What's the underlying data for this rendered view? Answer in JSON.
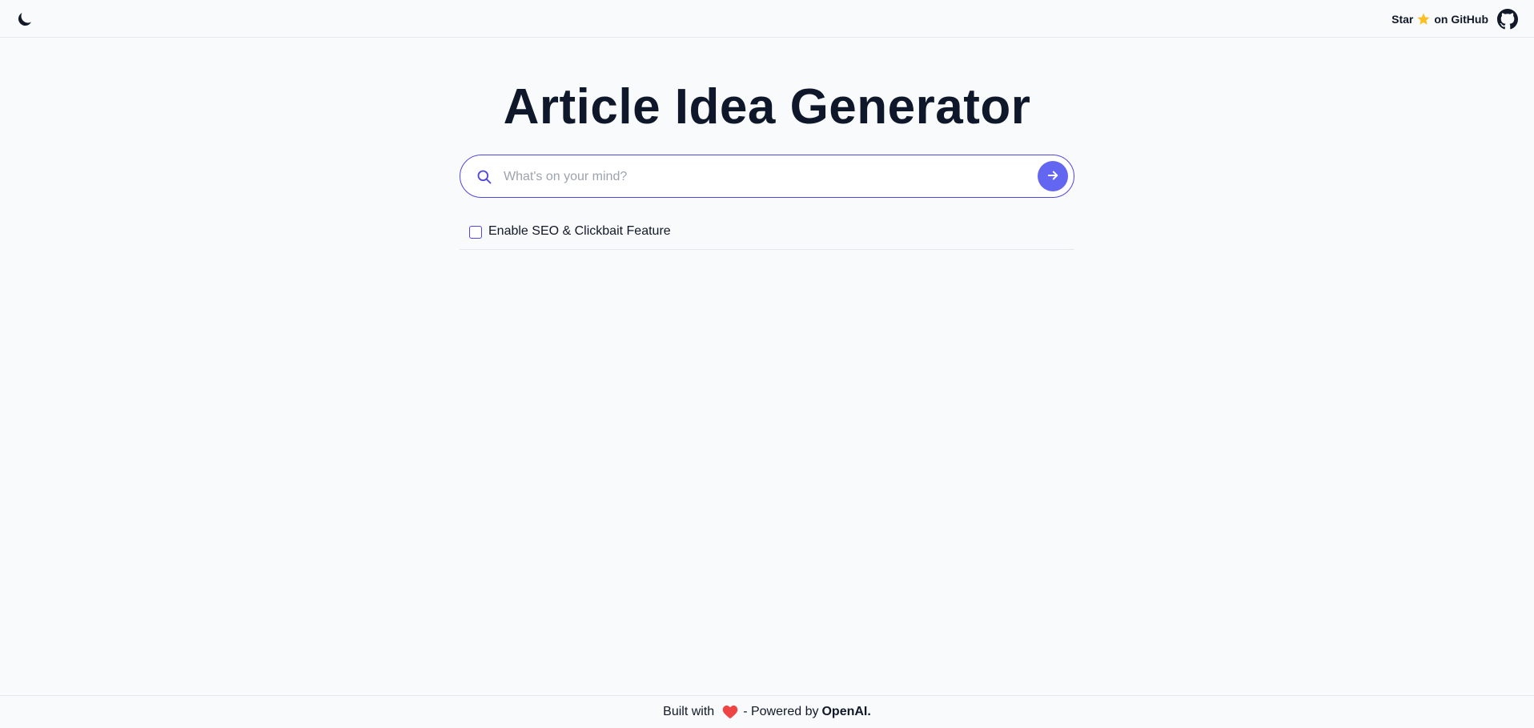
{
  "header": {
    "theme_icon": "moon-icon",
    "github_star_prefix": "Star",
    "github_star_icon": "star-icon",
    "github_star_suffix": "on GitHub",
    "github_icon": "github-icon"
  },
  "main": {
    "title": "Article Idea Generator",
    "search": {
      "placeholder": "What's on your mind?",
      "value": "",
      "icon": "search-icon",
      "submit_icon": "arrow-right-icon"
    },
    "seo_option": {
      "label": "Enable SEO & Clickbait Feature",
      "checked": false
    }
  },
  "footer": {
    "built_with": "Built with",
    "heart_icon": "heart-icon",
    "powered_by": "- Powered by",
    "brand": "OpenAI."
  },
  "colors": {
    "accent": "#6366f1",
    "border_accent": "#4f46e5",
    "heart": "#ef4444",
    "star": "#fbbf24",
    "background": "#f8fafc"
  }
}
